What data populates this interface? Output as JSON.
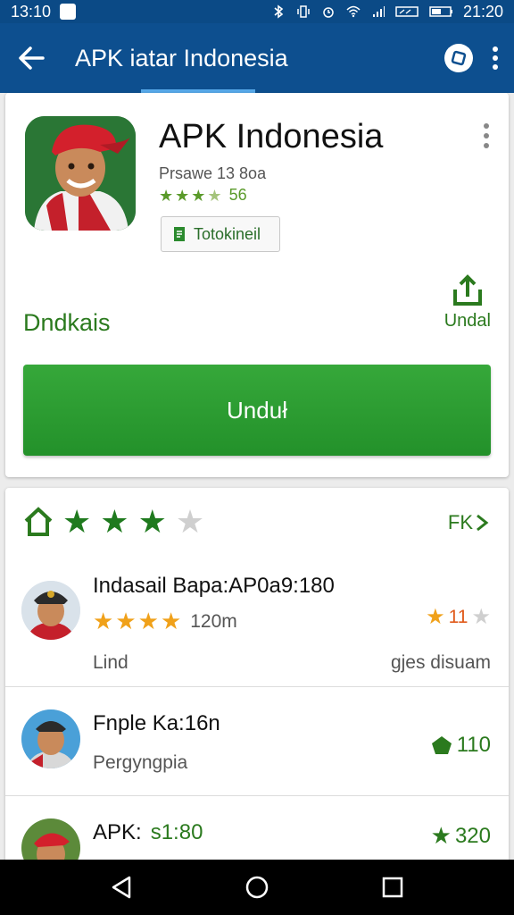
{
  "status_bar": {
    "time_left": "13:10",
    "time_right": "21:20"
  },
  "app_bar": {
    "title": "APK iatar Indonesia"
  },
  "app": {
    "name": "APK Indonesia",
    "meta": "Prsawe 13 8oa",
    "rating_value": "56",
    "tag_label": "Totokineil",
    "download_label": "Dndkais",
    "share_label": "Undal",
    "install_label": "Unduł"
  },
  "reviews_header": {
    "rating_stars": 4,
    "more_label": "FK"
  },
  "reviews": [
    {
      "name": "Indasail Bapa:AP0a9:180",
      "stars": 4,
      "stars_text": "120m",
      "sub": "Lind",
      "right_value": "11",
      "bottom_right": "gjes disuam"
    },
    {
      "name": "Fnple Ka:16n",
      "sub": "Pergyngpia",
      "right_value": "110"
    },
    {
      "name": "APK:",
      "name_extra": "s1:80",
      "right_value": "320"
    }
  ],
  "colors": {
    "primary": "#0d4f8f",
    "status": "#0b4a86",
    "accent_green": "#2b7a1e",
    "install_green": "#2a9a2e",
    "star_orange": "#f0a11a"
  }
}
